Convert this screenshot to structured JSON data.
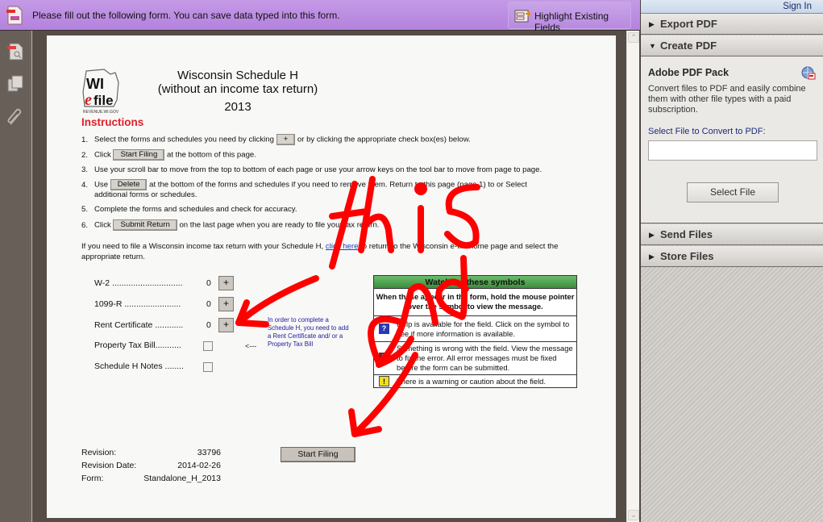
{
  "formbar": {
    "message": "Please fill out the following form. You can save data typed into this form.",
    "highlight_button": "Highlight Existing Fields"
  },
  "left_nav": {
    "icons": [
      "page-thumbnails-icon",
      "pages-icon",
      "attachments-icon"
    ]
  },
  "right_panel": {
    "sign_in": "Sign In",
    "sections": {
      "export_pdf": "Export PDF",
      "create_pdf": "Create PDF",
      "send_files": "Send Files",
      "store_files": "Store Files"
    },
    "create_pdf_body": {
      "title": "Adobe PDF Pack",
      "description": "Convert files to PDF and easily combine them with other file types with a paid subscription.",
      "field_label": "Select File to Convert to PDF:",
      "field_value": "",
      "button": "Select File"
    }
  },
  "document": {
    "logo": {
      "line1": "WI",
      "line2": "efile",
      "sub": "REVENUE.WI.GOV"
    },
    "instructions_heading": "Instructions",
    "title_line1": "Wisconsin Schedule H",
    "title_line2": "(without an income tax return)",
    "year": "2013",
    "steps": [
      {
        "num": "1.",
        "pre": "Select the forms and schedules you need by clicking",
        "btn": "+",
        "post": "or by clicking the appropriate check box(es) below."
      },
      {
        "num": "2.",
        "pre": "Click",
        "btn": "Start Filing",
        "post": "at the bottom of this page."
      },
      {
        "num": "3.",
        "pre": "Use your scroll bar to move from the top to bottom of each page or use your arrow keys on the tool bar to move from page to page.",
        "btn": "",
        "post": ""
      },
      {
        "num": "4.",
        "pre": "Use",
        "btn": "Delete",
        "post": "at the bottom of the forms and schedules if you need to remove them.  Return to this page (page 1) to or Select",
        "cont": "additional forms or schedules."
      },
      {
        "num": "5.",
        "pre": "Complete the forms and schedules and check for accuracy.",
        "btn": "",
        "post": ""
      },
      {
        "num": "6.",
        "pre": "Click",
        "btn": "Submit Return",
        "post": "on the last page when you are ready to file your tax return."
      }
    ],
    "paragraph_pre": "If you need to file a Wisconsin income tax return with your Schedule H,",
    "paragraph_link": "click here",
    "paragraph_post": "to return to the Wisconsin e-file home page and select the appropriate return.",
    "forms": [
      {
        "label": "W-2 ..............................",
        "count": "0",
        "control": "plus",
        "button": "+"
      },
      {
        "label": "1099-R ........................",
        "count": "0",
        "control": "plus",
        "button": "+"
      },
      {
        "label": "Rent Certificate ............",
        "count": "0",
        "control": "plus",
        "button": "+"
      },
      {
        "label": "Property Tax Bill...........",
        "control": "checkbox",
        "checked": false
      },
      {
        "label": "Schedule H Notes ........",
        "control": "checkbox",
        "checked": false
      }
    ],
    "note_arrow": "<---",
    "note": "In order to complete a Schedule H, you need to add a Rent Certificate and/ or a Property Tax Bill",
    "watch_box": {
      "header": "Watch for these symbols",
      "intro": "When these appear in the form, hold the mouse pointer over the symbol to view the message.",
      "rows": [
        {
          "symbol": "?",
          "symbol_color": "#2a3ab0",
          "text": "Help is available for the field. Click on the symbol to see if more information is available."
        },
        {
          "symbol": "X",
          "symbol_color": "#8a1a1a",
          "text": "Something is wrong with the field.  View the message to fix the error.  All error messages must be fixed before the form can be submitted."
        },
        {
          "symbol": "!",
          "symbol_color": "#f0e020",
          "text": "There is a warning or caution about the field."
        }
      ]
    },
    "revision_label": "Revision:",
    "revision_value": "33796",
    "revision_date_label": "Revision Date:",
    "revision_date_value": "2014-02-26",
    "form_label": "Form:",
    "form_value": "Standalone_H_2013",
    "start_filing_button": "Start Filing"
  },
  "annotation": {
    "words": [
      "this",
      "and"
    ],
    "color": "#ff0000"
  }
}
